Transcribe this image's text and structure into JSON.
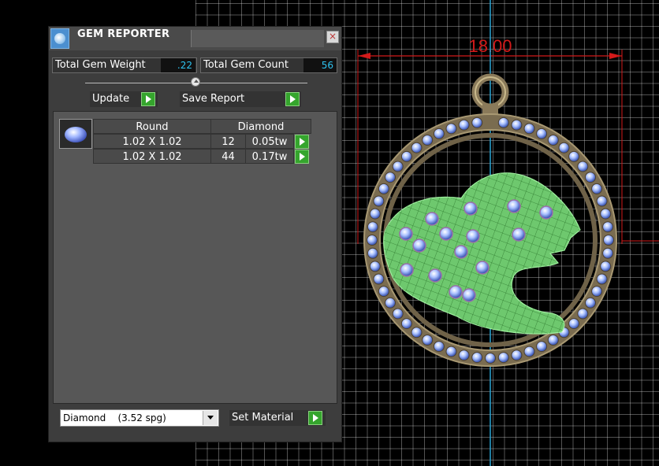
{
  "panel": {
    "title": "GEM REPORTER",
    "close_glyph": "×",
    "total_weight_label": "Total Gem Weight",
    "total_weight_value": ".22",
    "total_count_label": "Total Gem Count",
    "total_count_value": "56",
    "update_label": "Update",
    "save_report_label": "Save Report",
    "table": {
      "header_shape": "Round",
      "header_material": "Diamond",
      "rows": [
        {
          "size": "1.02 X 1.02",
          "count": "12",
          "weight": "0.05tw"
        },
        {
          "size": "1.02 X 1.02",
          "count": "44",
          "weight": "0.17tw"
        }
      ]
    },
    "material_select": "Diamond    (3.52 spg)",
    "set_material_label": "Set Material"
  },
  "viewport": {
    "dimension_label": "18.00",
    "colors": {
      "dimension": "#d21a1a",
      "axis": "#2aa6d6",
      "metal": "#8a7a5a",
      "mesh": "#7fd67f",
      "gem": "#8fb0ee"
    }
  }
}
